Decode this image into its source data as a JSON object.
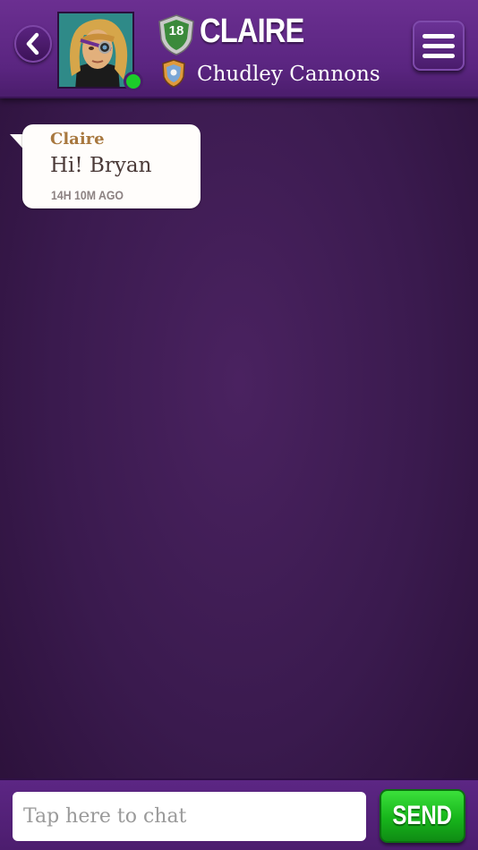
{
  "header": {
    "player_name": "CLAIRE",
    "level": "18",
    "team_name": "Chudley Cannons",
    "online_status_color": "#1ccc2a",
    "icons": {
      "back": "chevron-left-icon",
      "menu": "hamburger-menu-icon",
      "level_badge": "shield-icon",
      "team": "team-crest-icon"
    }
  },
  "messages": [
    {
      "sender": "Claire",
      "text": "Hi! Bryan",
      "time": "14H 10M AGO"
    }
  ],
  "composer": {
    "placeholder": "Tap here to chat",
    "value": "",
    "send_label": "SEND",
    "send_color": "#17b51b"
  }
}
